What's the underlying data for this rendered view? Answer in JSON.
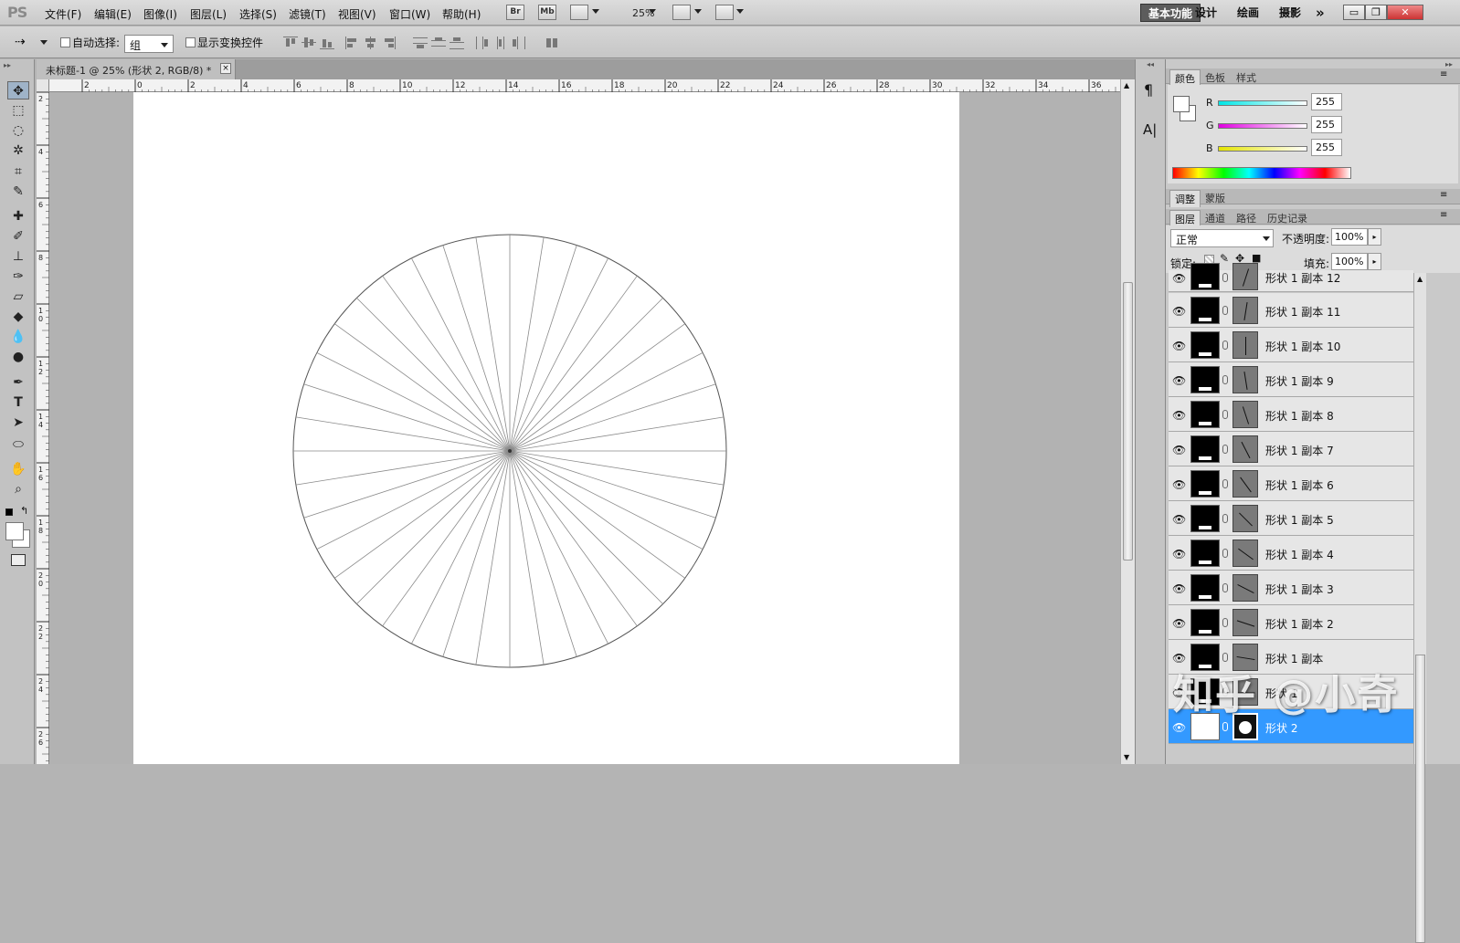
{
  "app": {
    "logo": "PS"
  },
  "menu": {
    "items": [
      "文件(F)",
      "编辑(E)",
      "图像(I)",
      "图层(L)",
      "选择(S)",
      "滤镜(T)",
      "视图(V)",
      "窗口(W)",
      "帮助(H)"
    ],
    "bridge_label": "Br",
    "minibridge_label": "Mb",
    "zoom": "25%",
    "workspaces": [
      "基本功能",
      "设计",
      "绘画",
      "摄影"
    ],
    "more": "»"
  },
  "options": {
    "auto_select_label": "自动选择:",
    "auto_select_value": "组",
    "show_transform_label": "显示变换控件"
  },
  "document": {
    "tab_title": "未标题-1 @ 25% (形状 2, RGB/8) *",
    "close": "×"
  },
  "rulers": {
    "h_ticks": [
      "2",
      "0",
      "2",
      "4",
      "6",
      "8",
      "10",
      "12",
      "14",
      "16",
      "18",
      "20",
      "22",
      "24",
      "26",
      "28",
      "30",
      "32",
      "34",
      "36"
    ],
    "v_ticks": [
      "2",
      "4",
      "6",
      "8",
      "10",
      "12",
      "14",
      "16",
      "18",
      "20",
      "22",
      "24",
      "26"
    ]
  },
  "icon_strip": {
    "paragraph": "¶",
    "character": "A|"
  },
  "color_panel": {
    "tabs": [
      "颜色",
      "色板",
      "样式"
    ],
    "channels": [
      {
        "name": "R",
        "value": "255"
      },
      {
        "name": "G",
        "value": "255"
      },
      {
        "name": "B",
        "value": "255"
      }
    ]
  },
  "adjust_panel": {
    "tabs": [
      "调整",
      "蒙版"
    ]
  },
  "layers_panel": {
    "tabs": [
      "图层",
      "通道",
      "路径",
      "历史记录"
    ],
    "blend_mode": "正常",
    "opacity_label": "不透明度:",
    "opacity": "100%",
    "lock_label": "锁定:",
    "fill_label": "填充:",
    "fill": "100%",
    "layers": [
      {
        "name": "形状 1 副本 12",
        "selected": false
      },
      {
        "name": "形状 1 副本 11",
        "selected": false
      },
      {
        "name": "形状 1 副本 10",
        "selected": false
      },
      {
        "name": "形状 1 副本 9",
        "selected": false
      },
      {
        "name": "形状 1 副本 8",
        "selected": false
      },
      {
        "name": "形状 1 副本 7",
        "selected": false
      },
      {
        "name": "形状 1 副本 6",
        "selected": false
      },
      {
        "name": "形状 1 副本 5",
        "selected": false
      },
      {
        "name": "形状 1 副本 4",
        "selected": false
      },
      {
        "name": "形状 1 副本 3",
        "selected": false
      },
      {
        "name": "形状 1 副本 2",
        "selected": false
      },
      {
        "name": "形状 1 副本",
        "selected": false
      },
      {
        "name": "形状 1",
        "selected": false
      },
      {
        "name": "形状 2",
        "selected": true
      }
    ]
  },
  "watermark": "知乎 @小奇",
  "colors": {
    "selection": "#3399ff",
    "canvas": "#ffffff",
    "pasteboard": "#b2b2b2"
  }
}
